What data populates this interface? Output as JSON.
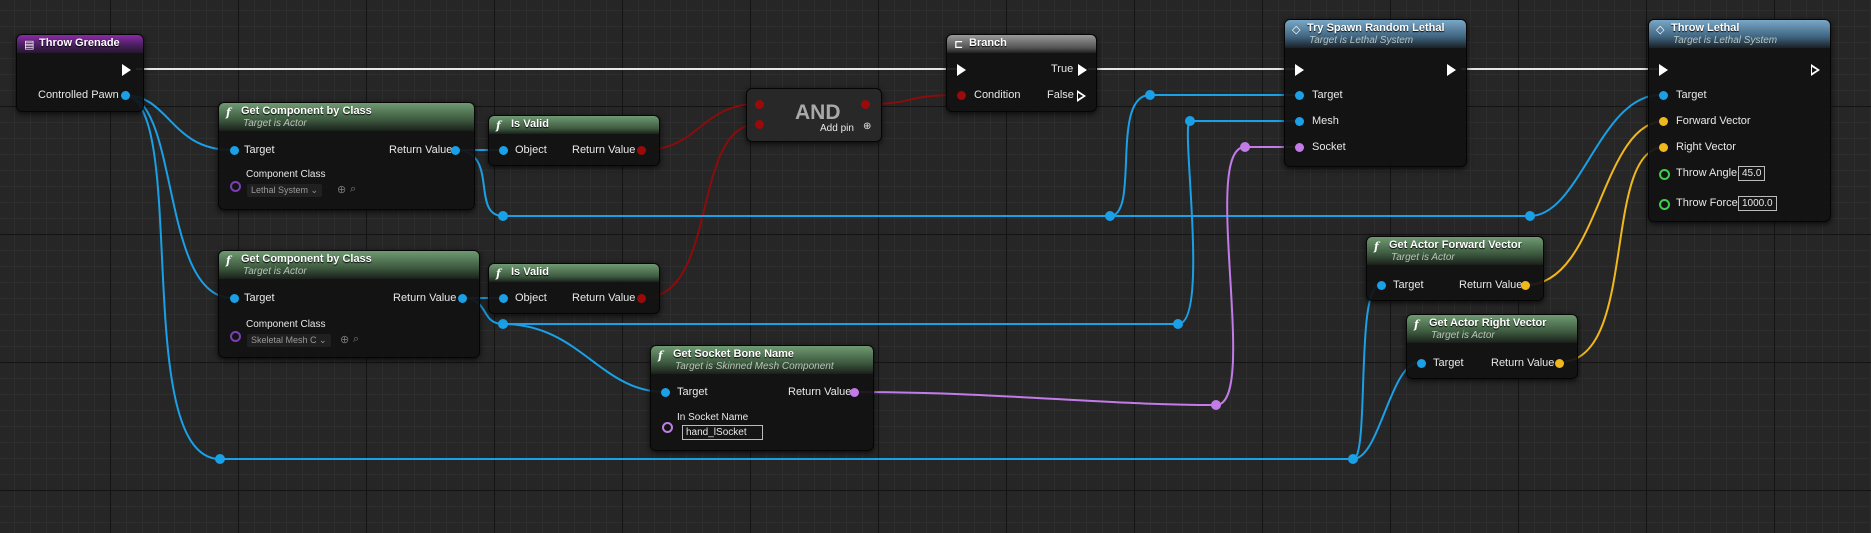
{
  "nodes": {
    "throw_grenade": {
      "title": "Throw Grenade",
      "pin_pawn": "Controlled Pawn"
    },
    "get_comp1": {
      "title": "Get Component by Class",
      "subtitle": "Target is Actor",
      "pin_target": "Target",
      "pin_return": "Return Value",
      "pin_class": "Component Class",
      "class_value": "Lethal System"
    },
    "is_valid1": {
      "title": "Is Valid",
      "pin_object": "Object",
      "pin_return": "Return Value"
    },
    "and": {
      "label": "AND",
      "add_pin": "Add pin"
    },
    "branch": {
      "title": "Branch",
      "pin_condition": "Condition",
      "pin_true": "True",
      "pin_false": "False"
    },
    "try_spawn": {
      "title": "Try Spawn Random Lethal",
      "subtitle": "Target is Lethal System",
      "pin_target": "Target",
      "pin_mesh": "Mesh",
      "pin_socket": "Socket"
    },
    "throw_lethal": {
      "title": "Throw Lethal",
      "subtitle": "Target is Lethal System",
      "pin_target": "Target",
      "pin_forward": "Forward Vector",
      "pin_right": "Right Vector",
      "pin_angle": "Throw Angle",
      "angle_value": "45.0",
      "pin_force": "Throw Force",
      "force_value": "1000.0"
    },
    "get_comp2": {
      "title": "Get Component by Class",
      "subtitle": "Target is Actor",
      "pin_target": "Target",
      "pin_return": "Return Value",
      "pin_class": "Component Class",
      "class_value": "Skeletal Mesh C"
    },
    "is_valid2": {
      "title": "Is Valid",
      "pin_object": "Object",
      "pin_return": "Return Value"
    },
    "socket_bone": {
      "title": "Get Socket Bone Name",
      "subtitle": "Target is Skinned Mesh Component",
      "pin_target": "Target",
      "pin_return": "Return Value",
      "pin_socket": "In Socket Name",
      "socket_value": "hand_lSocket"
    },
    "fwd_vec": {
      "title": "Get Actor Forward Vector",
      "subtitle": "Target is Actor",
      "pin_target": "Target",
      "pin_return": "Return Value"
    },
    "right_vec": {
      "title": "Get Actor Right Vector",
      "subtitle": "Target is Actor",
      "pin_target": "Target",
      "pin_return": "Return Value"
    }
  },
  "colors": {
    "exec": "#ffffff",
    "object": "#1aa0e6",
    "bool": "#9a0a0a",
    "vector": "#f0b81c",
    "name": "#c27be8",
    "float": "#3ad04a"
  },
  "icons": {
    "event": "event-icon",
    "function": "function-icon",
    "branch": "branch-icon",
    "interface": "interface-icon"
  }
}
